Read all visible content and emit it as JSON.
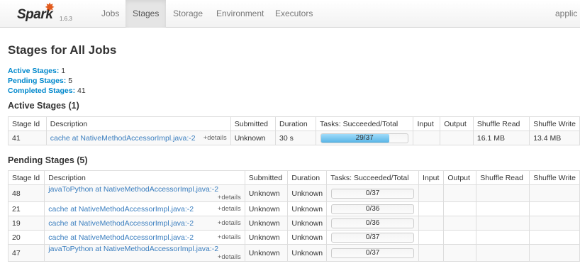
{
  "nav": {
    "brand": "Spark",
    "version": "1.6.3",
    "tabs": [
      "Jobs",
      "Stages",
      "Storage",
      "Environment",
      "Executors"
    ],
    "active_tab": "Stages",
    "right_text": "applic"
  },
  "page": {
    "title": "Stages for All Jobs"
  },
  "summary": [
    {
      "label": "Active Stages:",
      "value": "1"
    },
    {
      "label": "Pending Stages:",
      "value": "5"
    },
    {
      "label": "Completed Stages:",
      "value": "41"
    }
  ],
  "active_section": {
    "title": "Active Stages (1)",
    "columns": [
      "Stage Id",
      "Description",
      "Submitted",
      "Duration",
      "Tasks: Succeeded/Total",
      "Input",
      "Output",
      "Shuffle Read",
      "Shuffle Write"
    ],
    "rows": [
      {
        "stage_id": "41",
        "description": "cache at NativeMethodAccessorImpl.java:-2",
        "details": "+details",
        "submitted": "Unknown",
        "duration": "30 s",
        "tasks": "29/37",
        "progress": 0.784,
        "input": "",
        "output": "",
        "shuffle_read": "16.1 MB",
        "shuffle_write": "13.4 MB"
      }
    ]
  },
  "pending_section": {
    "title": "Pending Stages (5)",
    "columns": [
      "Stage Id",
      "Description",
      "Submitted",
      "Duration",
      "Tasks: Succeeded/Total",
      "Input",
      "Output",
      "Shuffle Read",
      "Shuffle Write"
    ],
    "rows": [
      {
        "stage_id": "48",
        "description": "javaToPython at NativeMethodAccessorImpl.java:-2",
        "details": "+details",
        "submitted": "Unknown",
        "duration": "Unknown",
        "tasks": "0/37",
        "progress": 0
      },
      {
        "stage_id": "21",
        "description": "cache at NativeMethodAccessorImpl.java:-2",
        "details": "+details",
        "submitted": "Unknown",
        "duration": "Unknown",
        "tasks": "0/36",
        "progress": 0
      },
      {
        "stage_id": "19",
        "description": "cache at NativeMethodAccessorImpl.java:-2",
        "details": "+details",
        "submitted": "Unknown",
        "duration": "Unknown",
        "tasks": "0/36",
        "progress": 0
      },
      {
        "stage_id": "20",
        "description": "cache at NativeMethodAccessorImpl.java:-2",
        "details": "+details",
        "submitted": "Unknown",
        "duration": "Unknown",
        "tasks": "0/37",
        "progress": 0
      },
      {
        "stage_id": "47",
        "description": "javaToPython at NativeMethodAccessorImpl.java:-2",
        "details": "+details",
        "submitted": "Unknown",
        "duration": "Unknown",
        "tasks": "0/37",
        "progress": 0
      }
    ]
  },
  "colors": {
    "link": "#3a7ebf",
    "summary_label": "#0088cc",
    "brand_star": "#e25a1c",
    "progress_fill": "#58b4e6"
  }
}
